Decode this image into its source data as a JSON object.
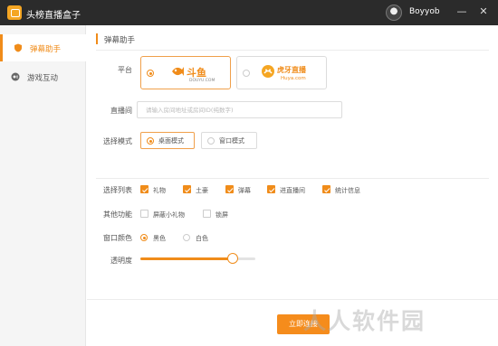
{
  "app": {
    "title": "头榜直播盒子",
    "username": "Boyyob"
  },
  "window_controls": {
    "minimize": "—",
    "close": "✕"
  },
  "sidebar": {
    "items": [
      {
        "label": "弹幕助手",
        "icon": "shield-icon",
        "active": true
      },
      {
        "label": "游戏互动",
        "icon": "gamepad-icon",
        "active": false
      }
    ]
  },
  "main": {
    "section_title": "弹幕助手",
    "platform": {
      "label": "平台",
      "options": [
        {
          "logo_text": "斗鱼",
          "sub": "DOUYU.COM",
          "selected": true
        },
        {
          "logo_text": "虎牙直播",
          "sub": "Huya.com",
          "selected": false
        }
      ]
    },
    "room": {
      "label": "直播间",
      "placeholder": "请输入房间地址或房间ID(纯数字)",
      "value": ""
    },
    "mode": {
      "label": "选择模式",
      "options": [
        {
          "label": "桌面模式",
          "selected": true
        },
        {
          "label": "窗口模式",
          "selected": false
        }
      ]
    },
    "list_select": {
      "label": "选择列表",
      "options": [
        {
          "label": "礼物",
          "checked": true
        },
        {
          "label": "土豪",
          "checked": true
        },
        {
          "label": "弹幕",
          "checked": true
        },
        {
          "label": "进直播间",
          "checked": true
        },
        {
          "label": "统计信息",
          "checked": true
        }
      ]
    },
    "other": {
      "label": "其他功能",
      "options": [
        {
          "label": "屏蔽小礼物",
          "checked": false
        },
        {
          "label": "锁屏",
          "checked": false
        }
      ]
    },
    "window_color": {
      "label": "窗口颜色",
      "options": [
        {
          "label": "黑色",
          "selected": true
        },
        {
          "label": "白色",
          "selected": false
        }
      ]
    },
    "opacity": {
      "label": "透明度",
      "value": 0.8
    },
    "start_button": "立即连接"
  },
  "watermark": "人人软件园",
  "colors": {
    "accent": "#F08C1A",
    "titlebar": "#2B2B2B"
  }
}
